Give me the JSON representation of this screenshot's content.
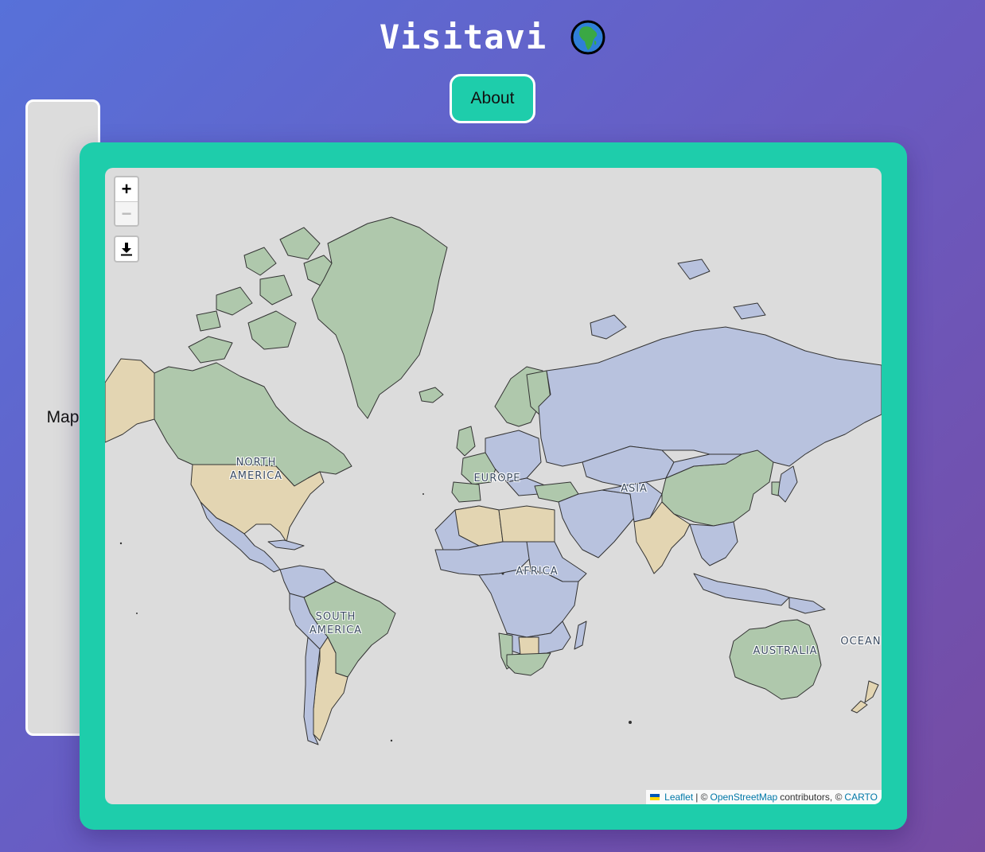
{
  "app": {
    "title": "Visitavi",
    "logo_icon": "globe-africa-emoji"
  },
  "nav": {
    "map_label": "Map",
    "about_label": "About"
  },
  "map": {
    "zoom_in_label": "+",
    "zoom_out_label": "−",
    "download_icon": "download-icon",
    "labels": {
      "north_america_1": "NORTH",
      "north_america_2": "AMERICA",
      "south_america_1": "SOUTH",
      "south_america_2": "AMERICA",
      "europe": "EUROPE",
      "asia": "ASIA",
      "africa": "AFRICA",
      "australia": "AUSTRALIA",
      "ocean": "OCEAN"
    },
    "attribution": {
      "leaflet": "Leaflet",
      "sep1": "| ©",
      "osm": "OpenStreetMap",
      "contrib": "contributors, ©",
      "carto": "CARTO"
    },
    "colors": {
      "background": "#dcdcdc",
      "green": "#afc8ac",
      "blue": "#b8c2de",
      "tan": "#e3d5b2",
      "border": "#333333"
    }
  }
}
